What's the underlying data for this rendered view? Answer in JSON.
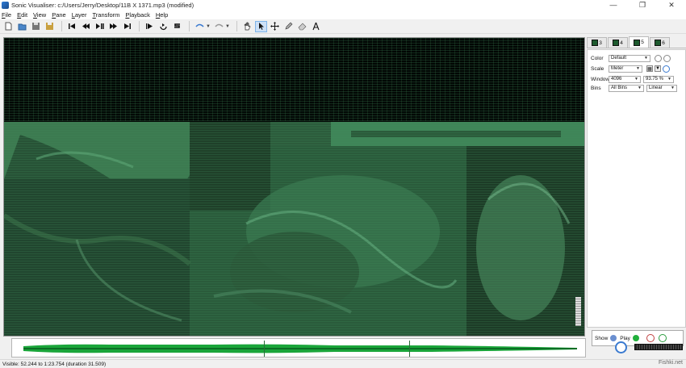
{
  "window": {
    "title": "Sonic Visualiser: c:/Users/Jerry/Desktop/11B X 1371.mp3 (modified)",
    "minimize": "—",
    "maximize": "❐",
    "close": "✕"
  },
  "menu": [
    "File",
    "Edit",
    "View",
    "Pane",
    "Layer",
    "Transform",
    "Playback",
    "Help"
  ],
  "toolbar": {
    "icons": [
      "new-file-icon",
      "open-file-icon",
      "save-icon",
      "save-as-icon",
      "rewind-start-icon",
      "rewind-icon",
      "play-pause-icon",
      "fast-forward-icon",
      "fast-forward-end-icon",
      "play-selection-icon",
      "loop-icon",
      "solo-icon",
      "align-icon",
      "undo-redo-icon",
      "navigate-hand-icon",
      "select-arrow-icon",
      "move-icon",
      "draw-pencil-icon",
      "erase-icon",
      "measure-icon"
    ]
  },
  "layer_tabs": [
    {
      "label": "3"
    },
    {
      "label": "4"
    },
    {
      "label": "5"
    },
    {
      "label": "6"
    }
  ],
  "properties": {
    "color_label": "Color",
    "color_value": "Default",
    "scale_label": "Scale",
    "scale_value": "Meter",
    "window_label": "Window",
    "window_value": "4096",
    "overlap_value": "93.75 %",
    "bins_label": "Bins",
    "bins_value": "All Bins",
    "bins_scale": "Linear"
  },
  "show_play": {
    "show_label": "Show",
    "play_label": "Play"
  },
  "status": {
    "visible": "Visible: 52.244 to 1:23.754 (duration 31.509)",
    "watermark": "Fishki.net"
  },
  "colors": {
    "spectrogram_bg": "#061008",
    "spectrogram_green": "#2e6d44",
    "waveform_green": "#1aa53a",
    "accent_blue": "#3a7ad0"
  }
}
